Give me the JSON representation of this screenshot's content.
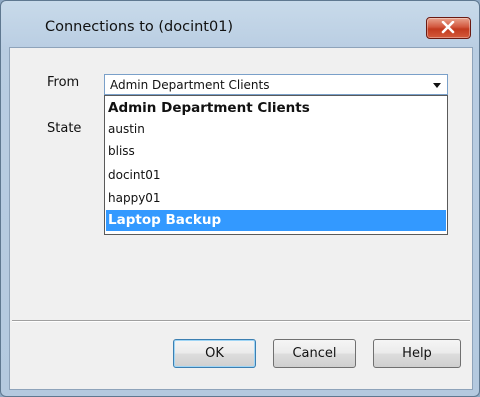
{
  "window": {
    "title": "Connections to (docint01)",
    "close_icon": "close-x-icon"
  },
  "form": {
    "from_label": "From",
    "state_label": "State",
    "from_value": "Admin Department Clients"
  },
  "dropdown": {
    "options": [
      {
        "label": "Admin Department Clients",
        "style": "bold"
      },
      {
        "label": "austin",
        "style": "normal"
      },
      {
        "label": "bliss",
        "style": "normal"
      },
      {
        "label": "docint01",
        "style": "normal"
      },
      {
        "label": "happy01",
        "style": "normal"
      },
      {
        "label": "Laptop Backup",
        "style": "highlighted"
      }
    ],
    "highlight_color": "#3399ff"
  },
  "buttons": {
    "ok": "OK",
    "cancel": "Cancel",
    "help": "Help"
  }
}
